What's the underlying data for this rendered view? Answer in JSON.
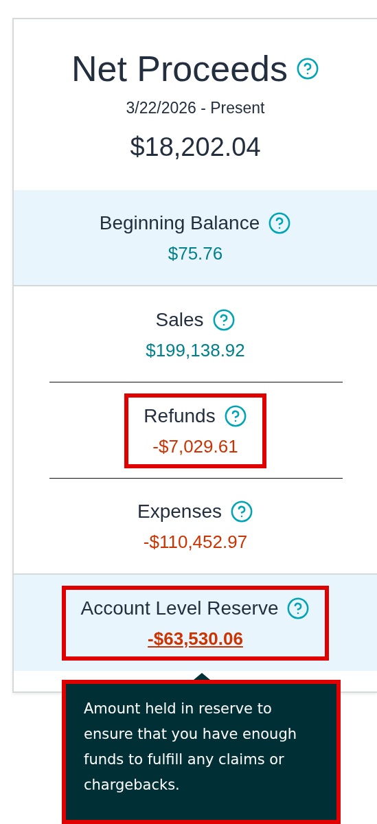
{
  "header": {
    "title": "Net Proceeds",
    "period": "3/22/2026 - Present",
    "total": "$18,202.04"
  },
  "sections": [
    {
      "label": "Beginning Balance",
      "value": "$75.76",
      "negative": false,
      "band": true,
      "highlighted": false,
      "link": false
    },
    {
      "label": "Sales",
      "value": "$199,138.92",
      "negative": false,
      "band": false,
      "highlighted": false,
      "link": false
    },
    {
      "label": "Refunds",
      "value": "-$7,029.61",
      "negative": true,
      "band": false,
      "highlighted": true,
      "link": false
    },
    {
      "label": "Expenses",
      "value": "-$110,452.97",
      "negative": true,
      "band": false,
      "highlighted": false,
      "link": false
    },
    {
      "label": "Account Level Reserve",
      "value": "-$63,530.06",
      "negative": true,
      "band": true,
      "highlighted": true,
      "link": true
    }
  ],
  "tooltip": {
    "text": "Amount held in reserve to ensure that you have enough funds to fulfill any claims or chargebacks.",
    "highlighted": true
  }
}
